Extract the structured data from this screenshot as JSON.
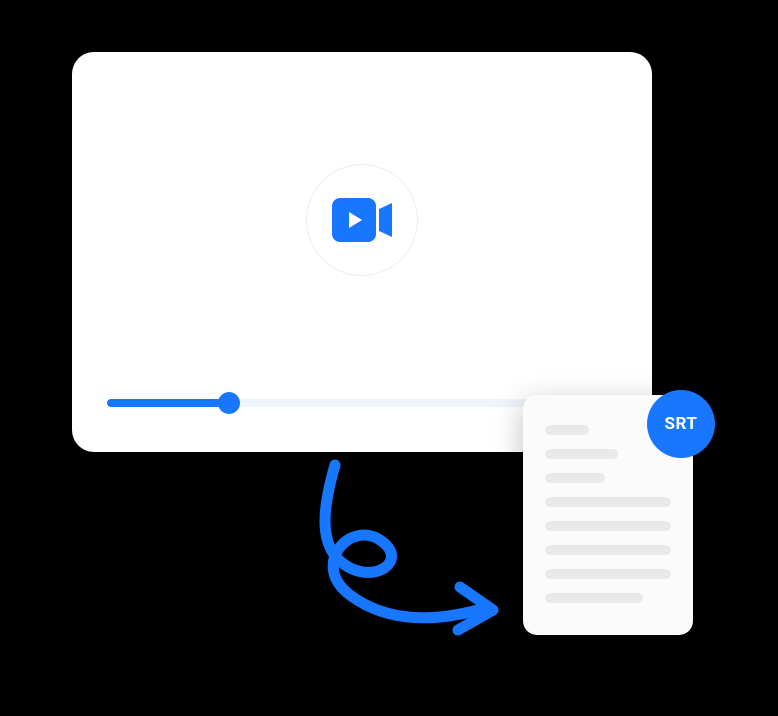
{
  "badge": {
    "label": "SRT"
  },
  "colors": {
    "accent": "#1877ff",
    "background": "#000000",
    "card": "#ffffff",
    "document": "#fbfbfb",
    "docline": "#e9e9e9"
  },
  "progress": {
    "percent": 24
  }
}
